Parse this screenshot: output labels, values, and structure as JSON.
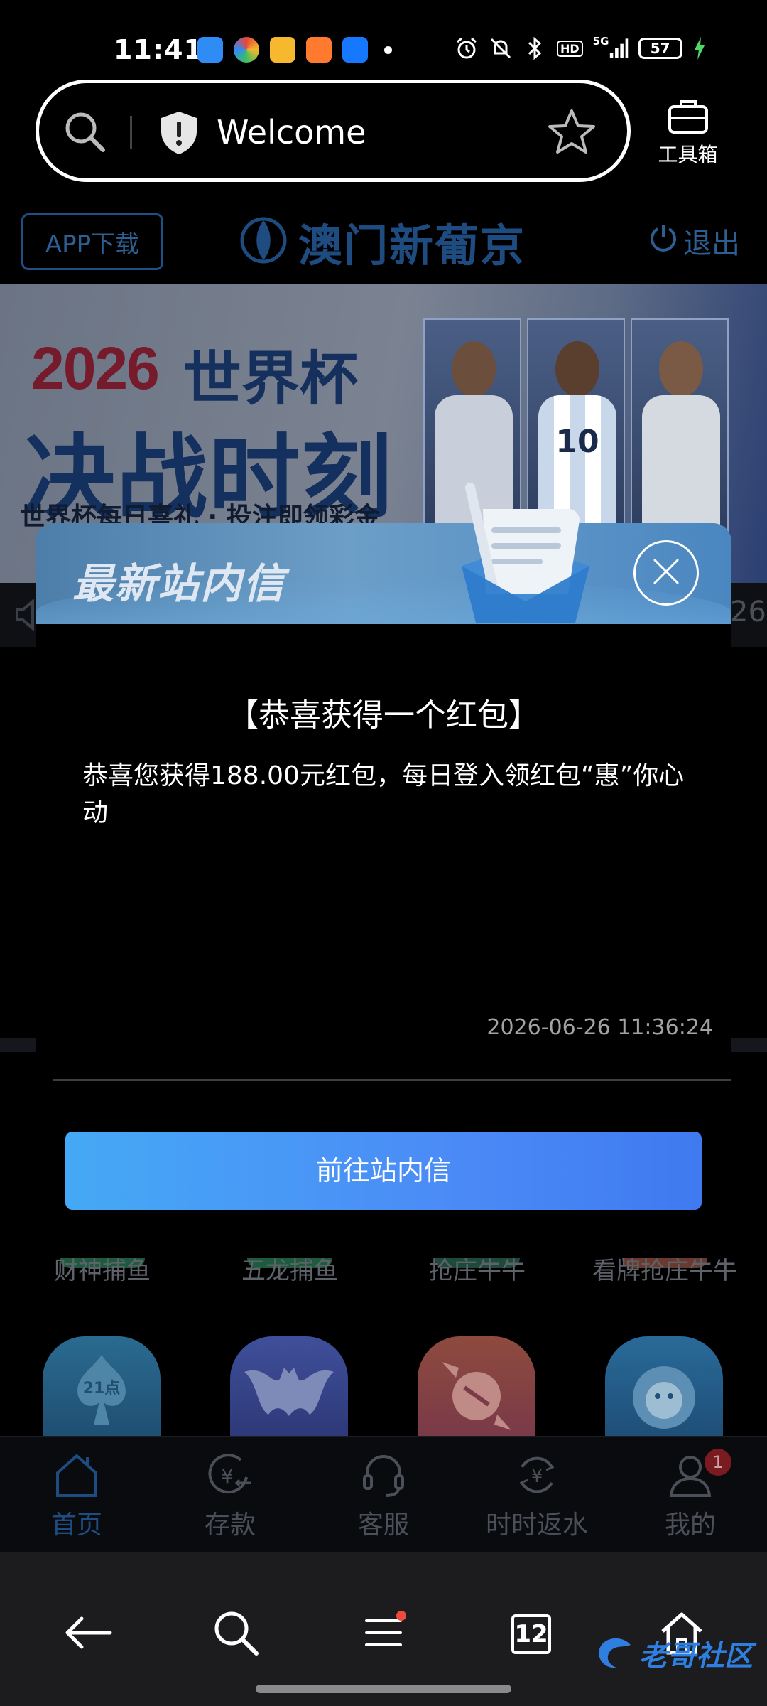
{
  "status_bar": {
    "time": "11:41",
    "network": "5G",
    "hd": "HD",
    "battery": "57",
    "app_icon_colors": [
      "#2f8cf5",
      "#e8463a",
      "#f5b82e",
      "#ff7a2e",
      "#1678ff"
    ]
  },
  "browser": {
    "url_title": "Welcome",
    "toolbox_label": "工具箱",
    "tab_count": "12"
  },
  "site": {
    "app_download": "APP下载",
    "logo_text": "澳门新葡京",
    "logout": "退出",
    "banner": {
      "year": "2026",
      "cup": "世界杯",
      "slogan": "决战时刻",
      "sub": "世界杯每日喜礼 · 投注即领彩金",
      "player_number": "10"
    },
    "marquee_tail": "26"
  },
  "modal": {
    "header_title": "最新站内信",
    "message_title": "【恭喜获得一个红包】",
    "message_body": "恭喜您获得188.00元红包，每日登入领红包“惠”你心动",
    "message_date": "2026-06-26 11:36:24",
    "button_label": "前往站内信"
  },
  "games": {
    "row_labels": [
      "财神捕鱼",
      "五龙捕鱼",
      "抢庄牛牛",
      "看牌抢庄牛牛"
    ],
    "tile_label_21": "21点"
  },
  "site_nav": {
    "items": [
      {
        "label": "首页",
        "icon": "home-icon",
        "active": true
      },
      {
        "label": "存款",
        "icon": "deposit-icon",
        "active": false
      },
      {
        "label": "客服",
        "icon": "headset-icon",
        "active": false
      },
      {
        "label": "时时返水",
        "icon": "rebate-icon",
        "active": false
      },
      {
        "label": "我的",
        "icon": "user-icon",
        "active": false
      }
    ],
    "my_badge": "1"
  },
  "watermark": "老哥社区",
  "colors": {
    "accent_blue": "#4b8bf6",
    "site_blue_dim": "#1e4c80",
    "badge_red": "#7a1b21"
  }
}
